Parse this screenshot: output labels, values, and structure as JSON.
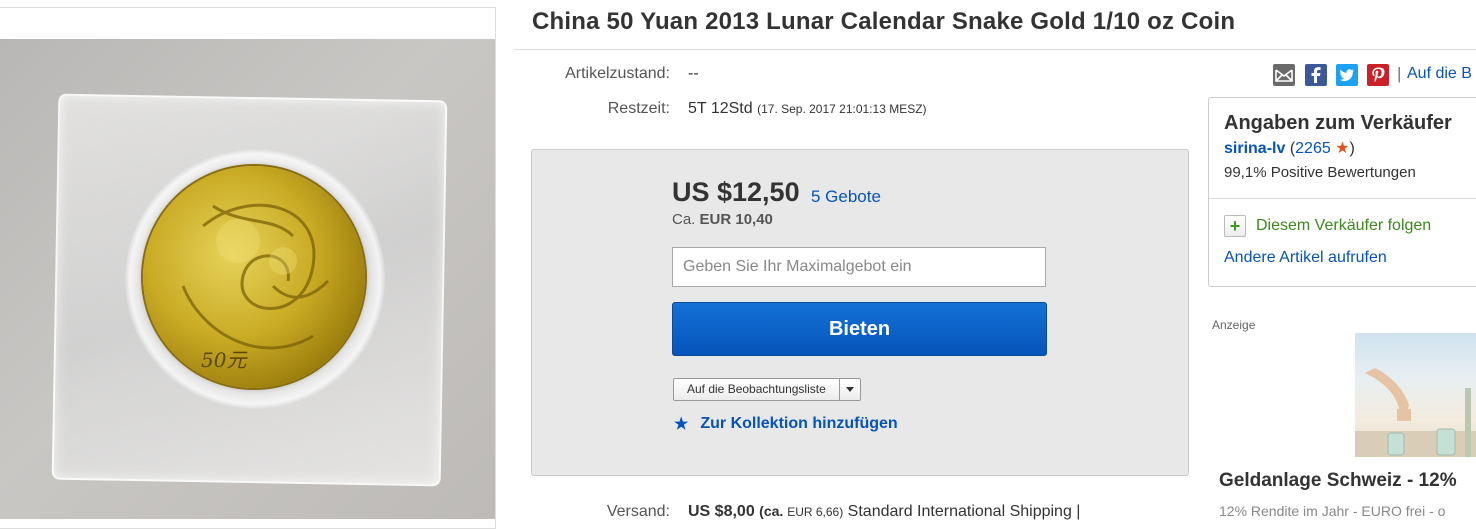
{
  "listing": {
    "title": "China 50 Yuan 2013 Lunar Calendar Snake Gold 1/10 oz Coin",
    "coin_denomination": "50元"
  },
  "details": {
    "condition_label": "Artikelzustand:",
    "condition_value": "--",
    "time_left_label": "Restzeit:",
    "time_left_value": "5T 12Std",
    "time_left_end": "(17. Sep. 2017  21:01:13 MESZ)"
  },
  "share": {
    "icons": [
      "email-icon",
      "facebook-icon",
      "twitter-icon",
      "pinterest-icon"
    ],
    "divider": "|",
    "watch_link": "Auf die B"
  },
  "bid": {
    "price": "US $12,50",
    "bid_count": "5 Gebote",
    "converted_prefix": "Ca.",
    "converted_value": "EUR 10,40",
    "input_placeholder": "Geben Sie Ihr Maximalgebot ein",
    "button_label": "Bieten",
    "watchlist_label": "Auf die Beobachtungsliste",
    "collection_label": "Zur Kollektion hinzufügen"
  },
  "shipping": {
    "label": "Versand:",
    "price": "US $8,00",
    "converted_open": "(ca.",
    "converted_value": "EUR 6,66)",
    "method": "Standard International Shipping |"
  },
  "seller": {
    "heading": "Angaben zum Verkäufer",
    "username": "sirina-lv",
    "score_open": "(",
    "score": "2265",
    "score_close": ")",
    "positive": "99,1% Positive Bewertungen",
    "follow_label": "Diesem Verkäufer folgen",
    "other_items": "Andere Artikel aufrufen"
  },
  "ad": {
    "label": "Anzeige",
    "title": "Geldanlage Schweiz - 12%",
    "text": "12% Rendite im Jahr - EURO frei - o"
  },
  "colors": {
    "link_blue": "#0654ba",
    "button_blue": "#0654ba",
    "follow_green": "#3a8a1b",
    "star_orange": "#e2501f"
  }
}
